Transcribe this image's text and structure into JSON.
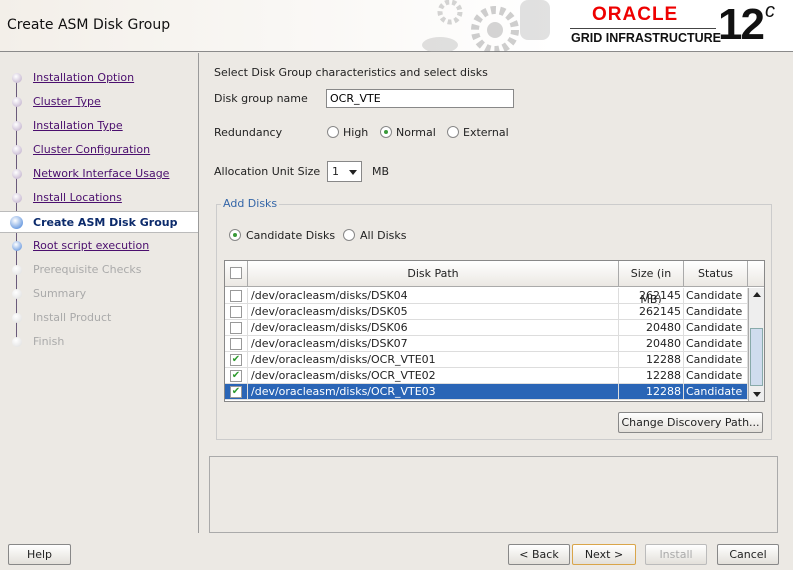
{
  "header": {
    "title": "Create ASM Disk Group",
    "brand": "ORACLE",
    "product": "GRID INFRASTRUCTURE",
    "version": "12",
    "version_suffix": "c"
  },
  "sidebar": {
    "steps": [
      {
        "label": "Installation Option",
        "state": "done"
      },
      {
        "label": "Cluster Type",
        "state": "done"
      },
      {
        "label": "Installation Type",
        "state": "done"
      },
      {
        "label": "Cluster Configuration",
        "state": "done"
      },
      {
        "label": "Network Interface Usage",
        "state": "done"
      },
      {
        "label": "Install Locations",
        "state": "done"
      },
      {
        "label": "Create ASM Disk Group",
        "state": "current"
      },
      {
        "label": "Root script execution",
        "state": "next"
      },
      {
        "label": "Prerequisite Checks",
        "state": "disabled"
      },
      {
        "label": "Summary",
        "state": "disabled"
      },
      {
        "label": "Install Product",
        "state": "disabled"
      },
      {
        "label": "Finish",
        "state": "disabled"
      }
    ]
  },
  "main": {
    "intro": "Select Disk Group characteristics and select disks",
    "dg_name_label": "Disk group name",
    "dg_name_value": "OCR_VTE",
    "redundancy_label": "Redundancy",
    "redundancy": {
      "high": "High",
      "normal": "Normal",
      "external": "External",
      "selected": "Normal"
    },
    "au_label": "Allocation Unit Size",
    "au_value": "1",
    "au_unit": "MB",
    "add_disks": {
      "legend": "Add Disks",
      "candidate": "Candidate Disks",
      "all": "All Disks",
      "selected": "Candidate Disks"
    },
    "table": {
      "headers": [
        "Disk Path",
        "Size (in MB)",
        "Status"
      ],
      "rows": [
        {
          "path": "/dev/oracleasm/disks/DSK04",
          "size": "262145",
          "status": "Candidate",
          "checked": false,
          "selected": false
        },
        {
          "path": "/dev/oracleasm/disks/DSK05",
          "size": "262145",
          "status": "Candidate",
          "checked": false,
          "selected": false
        },
        {
          "path": "/dev/oracleasm/disks/DSK06",
          "size": "20480",
          "status": "Candidate",
          "checked": false,
          "selected": false
        },
        {
          "path": "/dev/oracleasm/disks/DSK07",
          "size": "20480",
          "status": "Candidate",
          "checked": false,
          "selected": false
        },
        {
          "path": "/dev/oracleasm/disks/OCR_VTE01",
          "size": "12288",
          "status": "Candidate",
          "checked": true,
          "selected": false
        },
        {
          "path": "/dev/oracleasm/disks/OCR_VTE02",
          "size": "12288",
          "status": "Candidate",
          "checked": true,
          "selected": false
        },
        {
          "path": "/dev/oracleasm/disks/OCR_VTE03",
          "size": "12288",
          "status": "Candidate",
          "checked": true,
          "selected": true
        }
      ]
    },
    "change_path": "Change Discovery Path..."
  },
  "footer": {
    "help": "Help",
    "back": "< Back",
    "next": "Next >",
    "install": "Install",
    "cancel": "Cancel"
  },
  "colors": {
    "selection": "#2a65b6",
    "link": "#4b0f6e",
    "oracle_red": "#ee0000"
  }
}
